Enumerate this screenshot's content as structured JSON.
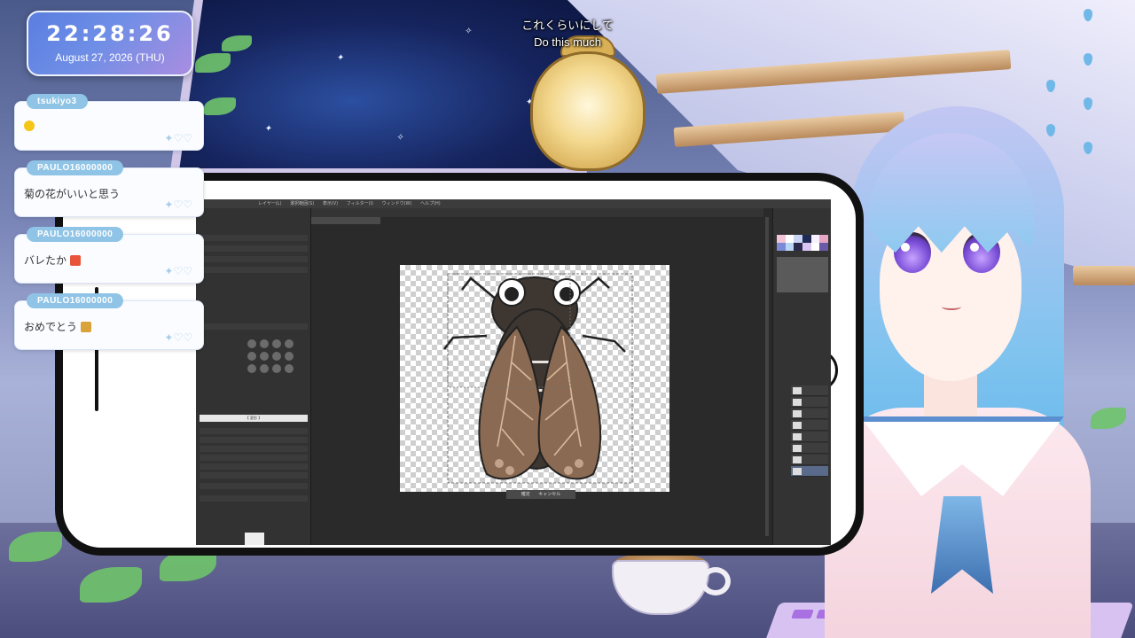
{
  "clock": {
    "time": "22:28:26",
    "date": "August 27, 2026 (THU)"
  },
  "subtitles": {
    "japanese": "これくらいにして",
    "english": "Do this much"
  },
  "chat": [
    {
      "user": "tsukiyo3",
      "text": ""
    },
    {
      "user": "PAULO16000000",
      "text": "菊の花がいいと思う"
    },
    {
      "user": "PAULO16000000",
      "text": "バレたか"
    },
    {
      "user": "PAULO16000000",
      "text": "おめでとう"
    }
  ],
  "app": {
    "menu": [
      "レイヤー(L)",
      "選択範囲(S)",
      "表示(V)",
      "フィルター(I)",
      "ウィンドウ(W)",
      "ヘルプ(H)"
    ],
    "tool_property_title": "【 変形 】",
    "confirm_label": "確定",
    "cancel_label": "キャンセル"
  },
  "colors": {
    "cicada_body": "#3e3731",
    "cicada_wing": "#8a6a52",
    "cicada_wing_vein": "#d9b99c",
    "chat_name_bg": "#8fc4e6"
  }
}
